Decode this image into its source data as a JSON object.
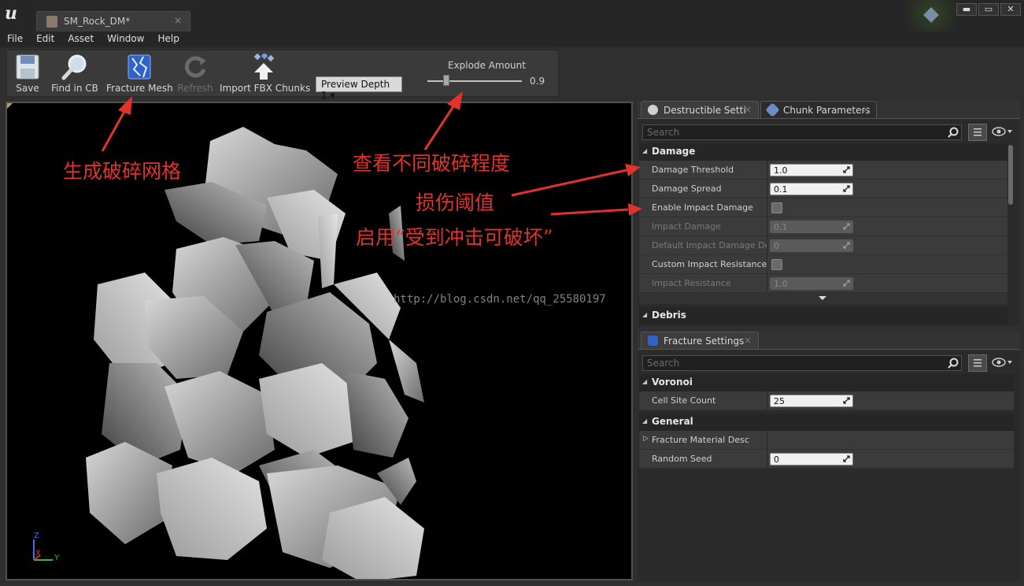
{
  "window": {
    "tab_title": "SM_Rock_DM*",
    "tab_close": "×",
    "controls": {
      "minimize": "▬",
      "maximize": "▭",
      "close": "✕"
    }
  },
  "menu": [
    "File",
    "Edit",
    "Asset",
    "Window",
    "Help"
  ],
  "toolbar": {
    "save": "Save",
    "find_in_cb": "Find in CB",
    "fracture_mesh": "Fracture Mesh",
    "refresh": "Refresh",
    "import_fbx_chunks": "Import FBX Chunks",
    "preview_depth": "Preview Depth 1 ▾",
    "explode_amount_label": "Explode Amount",
    "explode_amount_value": "0.9",
    "explode_amount_fraction": 0.2
  },
  "viewport": {
    "axis": {
      "z": "Z",
      "x": "X",
      "y": "Y"
    }
  },
  "destructible_panel": {
    "tabs": [
      "Destructible Settings",
      "Chunk Parameters"
    ],
    "search_placeholder": "Search",
    "categories": {
      "damage": "Damage",
      "debris": "Debris"
    },
    "damage_rows": [
      {
        "name": "Damage Threshold",
        "value": "1.0"
      },
      {
        "name": "Damage Spread",
        "value": "0.1"
      },
      {
        "name": "Enable Impact Damage",
        "value": ""
      },
      {
        "name": "Impact Damage",
        "value": "0.1"
      },
      {
        "name": "Default Impact Damage Depth",
        "value": "0"
      },
      {
        "name": "Custom Impact Resistance",
        "value": ""
      },
      {
        "name": "Impact Resistance",
        "value": "1.0"
      }
    ]
  },
  "fracture_panel": {
    "tab": "Fracture Settings",
    "search_placeholder": "Search",
    "categories": {
      "voronoi": "Voronoi",
      "general": "General"
    },
    "voronoi_rows": [
      {
        "name": "Cell Site Count",
        "value": "25"
      }
    ],
    "general_rows": [
      {
        "name": "Fracture Material Desc",
        "value": ""
      },
      {
        "name": "Random Seed",
        "value": "0"
      }
    ]
  },
  "annotations": {
    "fracture_mesh": "生成破碎网格",
    "explode_amount": "查看不同破碎程度",
    "damage_threshold": "损伤阈值",
    "enable_impact": "启用“受到冲击可破坏”"
  },
  "watermark": "http://blog.csdn.net/qq_25580197",
  "colors": {
    "annotation_red": "#e3322b",
    "panel_bg": "#333333",
    "viewport_bg": "#000000"
  }
}
